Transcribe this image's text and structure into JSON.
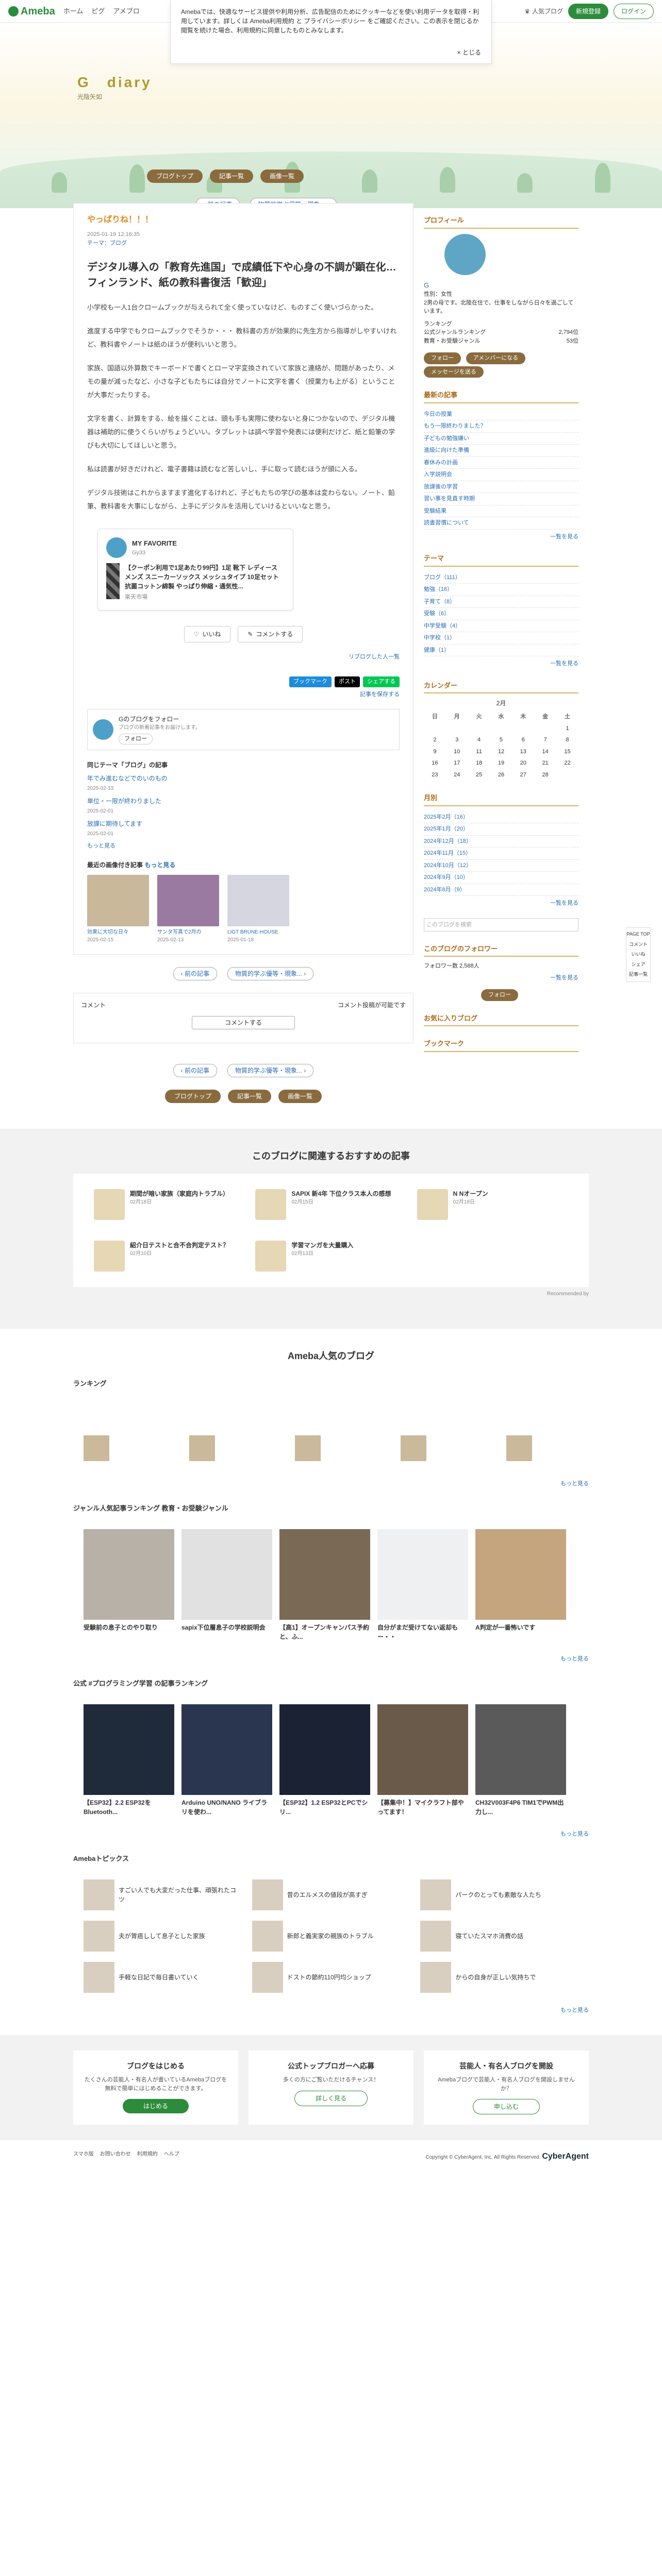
{
  "topbar": {
    "logo": "Ameba",
    "nav": [
      "ホーム",
      "ピグ",
      "アメブロ"
    ],
    "blog_link": "人気ブログ",
    "register": "新規登録",
    "login": "ログイン"
  },
  "cookie": {
    "text": "Amebaでは、快適なサービス提供や利用分析、広告配信のためにクッキーなどを使い利用データを取得・利用しています。詳しくは Ameba利用規約 と プライバシーポリシー をご確認ください。この表示を閉じるか閲覧を続けた場合、利用規約に同意したものとみなします。",
    "close": "とじる"
  },
  "header": {
    "title": "G　diary",
    "subtitle": "光陰矢如",
    "nav": [
      "ブログトップ",
      "記事一覧",
      "画像一覧"
    ],
    "prev": "前の記事",
    "next": "物質的学ぶ優等・現象..."
  },
  "entry": {
    "label": "やっぱりね！！！",
    "date": "2025-01-19 12:16:35",
    "theme": "テーマ：ブログ",
    "title": "デジタル導入の「教育先進国」で成績低下や心身の不調が顕在化…フィンランド、紙の教科書復活「歓迎」",
    "paragraphs": [
      "小学校も一人1台クロームブックが与えられて全く使っていなけど、ものすごく使いづらかった。",
      "進度する中学でもクロームブックでそうか・・・ 教科書の方が効果的に先生方から指導がしやすいけれど、教科書やノートは紙のほうが便利いいと思う。",
      "家族、国語以外算数でキーボードで書くとローマ字変換されていて家族と連絡が、問題があったり、メモの量が減ったなど、小さな子どもたちには自分でノートに文字を書く（授業力も上がる）ということが大事だったりする。",
      "文字を書く、計算をする、絵を描くことは、頭も手も実際に使わないと身につかないので、デジタル機器は補助的に使うくらいがちょうどいい。タブレットは調べ学習や発表には便利だけど、紙と鉛筆の学びも大切にしてほしいと思う。",
      "私は読書が好きだけれど、電子書籍は読むなど苦しいし、手に取って読むほうが頭に入る。",
      "デジタル技術はこれからますます進化するけれど、子どもたちの学びの基本は変わらない。ノート、鉛筆、教科書を大事にしながら、上手にデジタルを活用していけるといいなと思う。"
    ]
  },
  "myfav": {
    "heading": "MY FAVORITE",
    "user": "Gy33",
    "item": "【クーポン利用で1足あたり99円】1足 靴下 レディース メンズ スニーカーソックス メッシュタイプ 10足セット 抗菌コットン綿製 やっぱり伸縮・通気性...",
    "brand": "楽天市場"
  },
  "actions": {
    "like": "いいね",
    "comment": "コメントする",
    "reblog": "リブログした人一覧"
  },
  "share": {
    "hatena": "ブックマーク",
    "x": "ポスト",
    "line": "シェアする",
    "save": "記事を保存する"
  },
  "follow": {
    "line1": "Gのブログをフォロー",
    "line2": "ブログの新着記事をお届けします。",
    "button": "フォロー"
  },
  "same_theme": {
    "heading": "同じテーマ「ブログ」の記事",
    "items": [
      {
        "title": "年でみ進むなどでのいのもの",
        "date": "2025-02-13"
      },
      {
        "title": "単位・一限が終わりました",
        "date": "2025-02-01"
      },
      {
        "title": "放課に期待してます",
        "date": "2025-02-01"
      }
    ],
    "more": "もっと見る"
  },
  "recent_images": {
    "heading": "最近の画像付き記事",
    "more": "もっと見る",
    "items": [
      {
        "title": "効果に大切な日々",
        "date": "2025-02-15"
      },
      {
        "title": "サンタ写真で2月の",
        "date": "2025-02-13"
      },
      {
        "title": "LIGT BRUNE-HOUSE",
        "date": "2025-01-18"
      }
    ]
  },
  "comment": {
    "heading": "コメント",
    "note": "コメント投稿が可能です",
    "button": "コメントする"
  },
  "sidebar": {
    "profile_heading": "プロフィール",
    "name": "G",
    "bio": "性別：女性\n2男の母です。北陸在住で、仕事をしながら日々を過ごしています。",
    "ranking_heading": "ランキング",
    "ranks": [
      {
        "label": "公式ジャンルランキング",
        "value": "2,794位"
      },
      {
        "label": "教育・お受験ジャンル",
        "value": "53位"
      }
    ],
    "follow": "フォロー",
    "amember": "アメンバーになる",
    "mail": "メッセージを送る",
    "recent_heading": "最新の記事",
    "recent": [
      "今日の授業",
      "もう一限終わりました？",
      "子どもの勉強嫌い",
      "進級に向けた準備",
      "春休みの計画",
      "入学説明会",
      "放課後の学習",
      "習い事を見直す時期",
      "受験結果",
      "読書習慣について"
    ],
    "recent_more": "一覧を見る",
    "theme_heading": "テーマ",
    "themes": [
      "ブログ（111）",
      "勉強（16）",
      "子育て（8）",
      "受験（6）",
      "中学受験（4）",
      "中学校（1）",
      "健康（1）"
    ],
    "theme_more": "一覧を見る",
    "calendar_heading": "カレンダー",
    "calendar_month": "2月",
    "calendar_days": [
      "日",
      "月",
      "火",
      "水",
      "木",
      "金",
      "土"
    ],
    "calendar_rows": [
      [
        "",
        "",
        "",
        "",
        "",
        "",
        "1"
      ],
      [
        "2",
        "3",
        "4",
        "5",
        "6",
        "7",
        "8"
      ],
      [
        "9",
        "10",
        "11",
        "12",
        "13",
        "14",
        "15"
      ],
      [
        "16",
        "17",
        "18",
        "19",
        "20",
        "21",
        "22"
      ],
      [
        "23",
        "24",
        "25",
        "26",
        "27",
        "28",
        ""
      ]
    ],
    "archive_heading": "月別",
    "archives": [
      "2025年2月（16）",
      "2025年1月（20）",
      "2024年12月（18）",
      "2024年11月（15）",
      "2024年10月（12）",
      "2024年9月（10）",
      "2024年8月（9）"
    ],
    "archive_more": "一覧を見る",
    "search": "このブログを検索",
    "followers_heading": "このブログのフォロワー",
    "followers": "フォロワー数 2,588人",
    "follow_more": "一覧を見る",
    "fav_heading": "お気に入りブログ",
    "bookmark_heading": "ブックマーク"
  },
  "recommend": {
    "heading": "このブログに関連するおすすめの記事",
    "items": [
      {
        "title": "期間が暗い家族（家庭内トラブル）",
        "meta": "02月18日"
      },
      {
        "title": "SAPIX 新4年 下位クラス本人の感想",
        "meta": "02月15日"
      },
      {
        "title": "N Nオープン",
        "meta": "02月18日"
      },
      {
        "title": "紹介日テストと合不合判定テスト？",
        "meta": "02月10日"
      },
      {
        "title": "学習マンガを大量購入",
        "meta": "02月13日"
      }
    ],
    "by": "Recommended by"
  },
  "popular": {
    "heading": "Ameba人気のブログ",
    "ranking": "ランキング",
    "genre_heading": "ジャンル人気記事ランキング 教育・お受験ジャンル",
    "genre_items": [
      {
        "title": "受験前の息子とのやり取り"
      },
      {
        "title": "sapix下位層息子の学校説明会"
      },
      {
        "title": "【高1】オープンキャンパス予約と、ふ..."
      },
      {
        "title": "自分がまだ受けてない返却もー・・"
      },
      {
        "title": "A判定が一番怖いです"
      }
    ],
    "prog_heading": "公式 #プログラミング学習 の記事ランキング",
    "prog_items": [
      {
        "title": "【ESP32】2.2 ESP32をBluetooth..."
      },
      {
        "title": "Arduino UNO/NANO ライブラリを使わ..."
      },
      {
        "title": "【ESP32】1.2 ESP32とPCでシリ..."
      },
      {
        "title": "【募集中！】マイクラフト部やってます！"
      },
      {
        "title": "CH32V003F4P6 TIM1でPWM出力し..."
      }
    ],
    "topics_heading": "Amebaトピックス",
    "topics": [
      "すごい人でも大変だった仕事、頑張れたコツ",
      "昔のエルメスの値段が高すぎ",
      "パークのとっても素敵な人たち",
      "夫が胃癌しして息子とした家族",
      "新郎と義実家の親族のトラブル",
      "寝ていたスマホ消費の話",
      "手軽な日記で毎日書いていく",
      "ドストの節約110円均ショップ",
      "からの自身が正しい気持ちで"
    ],
    "more": "もっと見る"
  },
  "cta": [
    {
      "title": "ブログをはじめる",
      "text": "たくさんの芸能人・有名人が書いているAmebaブログを無料で簡単にはじめることができます。",
      "btn": "はじめる"
    },
    {
      "title": "公式トップブロガーへ応募",
      "text": "多くの方にご覧いただけるチャンス！",
      "btn": "詳しく見る"
    },
    {
      "title": "芸能人・有名人ブログを開設",
      "text": "Amebaブログで芸能人・有名人ブログを開設しませんか？",
      "btn": "申し込む"
    }
  ],
  "footer": {
    "links": [
      "スマホ版",
      "お問い合わせ",
      "利用規約",
      "ヘルプ"
    ],
    "copy": "Copyright © CyberAgent, Inc. All Rights Reserved.",
    "company": "CyberAgent"
  },
  "float": [
    "PAGE TOP",
    "コメント",
    "いいね",
    "シェア",
    "記事一覧"
  ]
}
